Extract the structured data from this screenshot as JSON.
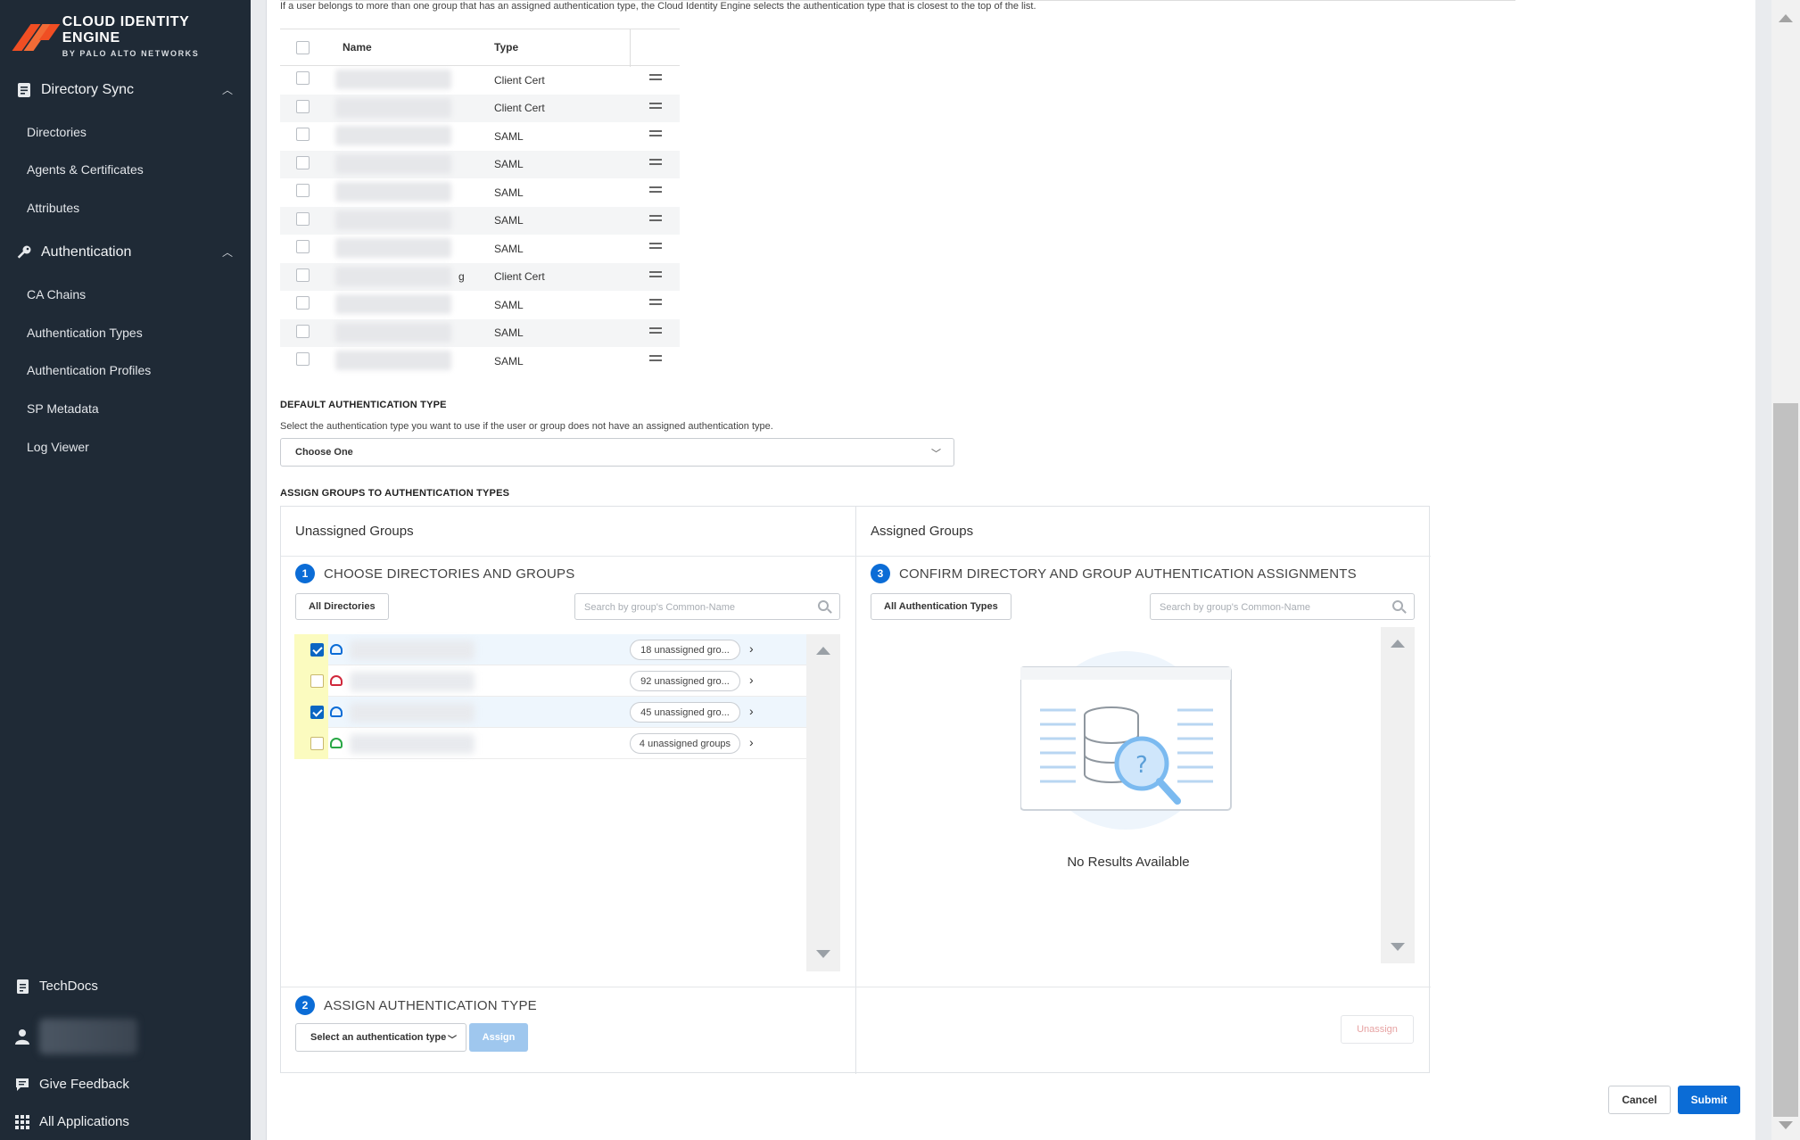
{
  "brand": {
    "title": "CLOUD IDENTITY ENGINE",
    "subtitle": "BY PALO ALTO NETWORKS"
  },
  "sidebar": {
    "sections": [
      {
        "label": "Directory Sync",
        "icon": "document-icon",
        "items": [
          "Directories",
          "Agents & Certificates",
          "Attributes"
        ]
      },
      {
        "label": "Authentication",
        "icon": "key-icon",
        "items": [
          "CA Chains",
          "Authentication Types",
          "Authentication Profiles",
          "SP Metadata",
          "Log Viewer"
        ]
      }
    ],
    "bottom": {
      "techdocs": "TechDocs",
      "feedback": "Give Feedback",
      "apps": "All Applications"
    }
  },
  "priority_note": "If a user belongs to more than one group that has an assigned authentication type, the Cloud Identity Engine selects the authentication type that is closest to the top of the list.",
  "priority_table": {
    "headers": {
      "name": "Name",
      "type": "Type"
    },
    "rows": [
      {
        "type": "Client Cert",
        "suffix": ""
      },
      {
        "type": "Client Cert",
        "suffix": ""
      },
      {
        "type": "SAML",
        "suffix": ""
      },
      {
        "type": "SAML",
        "suffix": ""
      },
      {
        "type": "SAML",
        "suffix": ""
      },
      {
        "type": "SAML",
        "suffix": ""
      },
      {
        "type": "SAML",
        "suffix": ""
      },
      {
        "type": "Client Cert",
        "suffix": "g"
      },
      {
        "type": "SAML",
        "suffix": ""
      },
      {
        "type": "SAML",
        "suffix": ""
      },
      {
        "type": "SAML",
        "suffix": ""
      }
    ]
  },
  "default_auth": {
    "title": "DEFAULT AUTHENTICATION TYPE",
    "description": "Select the authentication type you want to use if the user or group does not have an assigned authentication type.",
    "value": "Choose One"
  },
  "assign": {
    "title": "ASSIGN GROUPS TO AUTHENTICATION TYPES",
    "unassigned_title": "Unassigned Groups",
    "assigned_title": "Assigned Groups",
    "step1": {
      "num": "1",
      "label": "CHOOSE DIRECTORIES AND GROUPS"
    },
    "step2": {
      "num": "2",
      "label": "ASSIGN AUTHENTICATION TYPE"
    },
    "step3": {
      "num": "3",
      "label": "CONFIRM DIRECTORY AND GROUP AUTHENTICATION ASSIGNMENTS"
    },
    "all_directories": "All Directories",
    "all_auth_types": "All Authentication Types",
    "search_placeholder": "Search by group's Common-Name",
    "directories": [
      {
        "checked": true,
        "status": "blue",
        "count": "18 unassigned gro..."
      },
      {
        "checked": false,
        "status": "red",
        "count": "92 unassigned gro..."
      },
      {
        "checked": true,
        "status": "blue",
        "count": "45 unassigned gro..."
      },
      {
        "checked": false,
        "status": "green",
        "count": "4 unassigned groups"
      }
    ],
    "empty_text": "No Results Available",
    "auth_select": "Select an authentication type",
    "assign_button": "Assign",
    "unassign_button": "Unassign"
  },
  "footer": {
    "cancel": "Cancel",
    "submit": "Submit"
  },
  "colors": {
    "sidebar": "#1f2a36",
    "accent": "#0b6cd6",
    "brand": "#f04e23"
  }
}
